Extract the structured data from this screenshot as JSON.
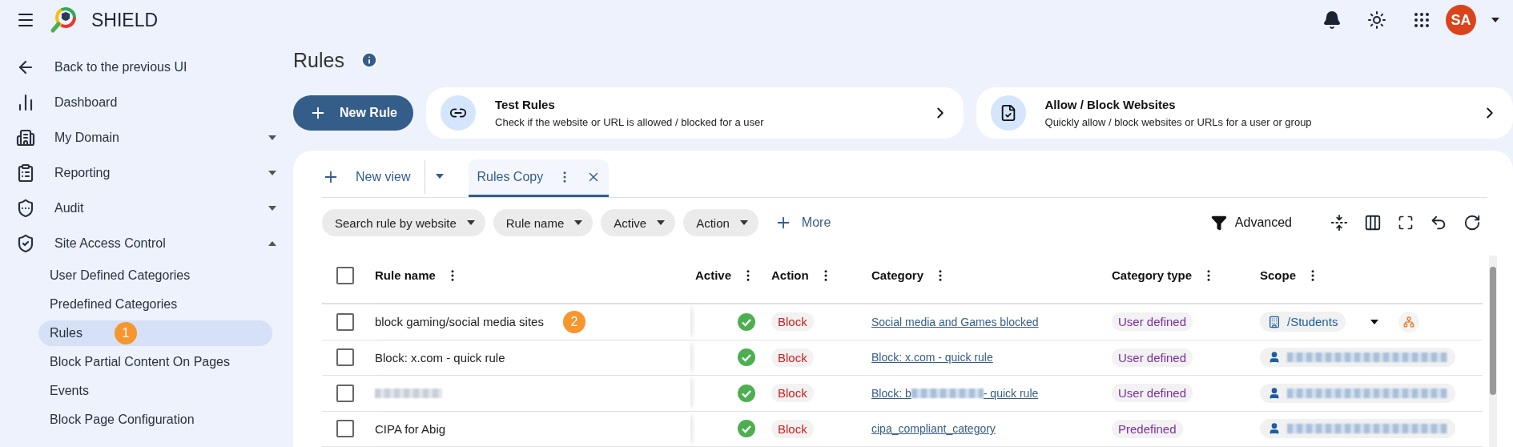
{
  "app": {
    "name": "SHIELD",
    "avatar": "SA"
  },
  "sidebar": {
    "items": [
      {
        "label": "Back to the previous UI"
      },
      {
        "label": "Dashboard"
      },
      {
        "label": "My Domain",
        "expanded": false
      },
      {
        "label": "Reporting",
        "expanded": false
      },
      {
        "label": "Audit",
        "expanded": false
      },
      {
        "label": "Site Access Control",
        "expanded": true,
        "children": [
          {
            "label": "User Defined Categories",
            "selected": false
          },
          {
            "label": "Predefined Categories",
            "selected": false
          },
          {
            "label": "Rules",
            "selected": true,
            "badge": "1"
          },
          {
            "label": "Block Partial Content On Pages",
            "selected": false
          },
          {
            "label": "Events",
            "selected": false
          },
          {
            "label": "Block Page Configuration",
            "selected": false
          }
        ]
      }
    ]
  },
  "page": {
    "title": "Rules"
  },
  "new_rule_button": "New Rule",
  "cards": [
    {
      "title": "Test Rules",
      "text": "Check if the website or URL is allowed / blocked for a user"
    },
    {
      "title": "Allow / Block Websites",
      "text": "Quickly allow / block websites or URLs for a user or group"
    }
  ],
  "views": {
    "new_view": "New view",
    "tabs": [
      {
        "label": "Rules Copy",
        "selected": true
      }
    ]
  },
  "filters": [
    "Search rule by website",
    "Rule name",
    "Active",
    "Action"
  ],
  "more": "More",
  "advanced": "Advanced",
  "table": {
    "select_all_checked": false,
    "columns": [
      "Rule name",
      "Active",
      "Action",
      "Category",
      "Category type",
      "Scope"
    ],
    "rows": [
      {
        "checked": false,
        "name": "block gaming/social media sites",
        "badge": "2",
        "active": true,
        "action": "Block",
        "category": "Social media and Games blocked",
        "category_type": "User defined",
        "scope": {
          "kind": "org",
          "text": "/Students"
        }
      },
      {
        "checked": false,
        "name": "Block: x.com - quick rule",
        "active": true,
        "action": "Block",
        "category": "Block: x.com - quick rule",
        "category_type": "User defined",
        "scope": {
          "kind": "user"
        }
      },
      {
        "checked": false,
        "name_redacted": true,
        "active": true,
        "action": "Block",
        "category": "Block: b",
        "category_suffix": " - quick rule",
        "category_type": "User defined",
        "scope": {
          "kind": "user"
        }
      },
      {
        "checked": false,
        "name": "CIPA for Abig",
        "active": true,
        "action": "Block",
        "category": "cipa_compliant_category",
        "category_type": "Predefined",
        "scope": {
          "kind": "user"
        }
      }
    ]
  }
}
